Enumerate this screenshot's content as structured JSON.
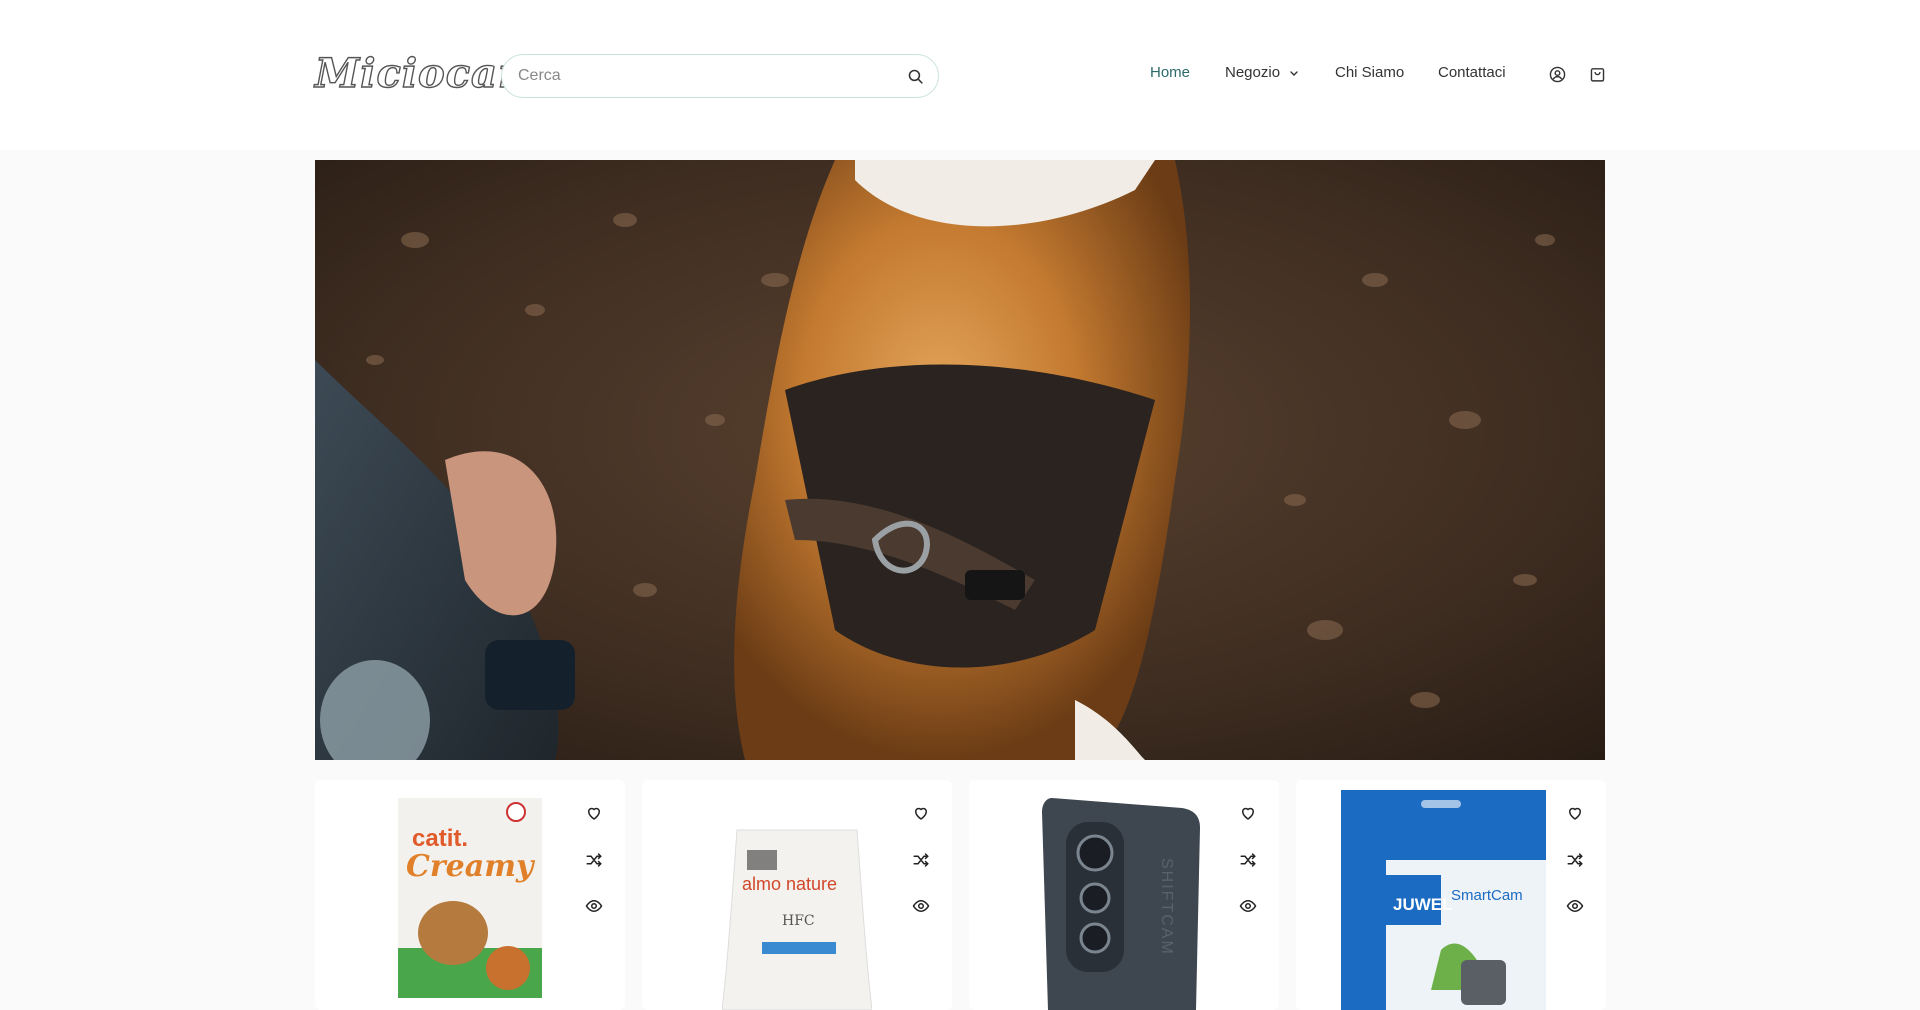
{
  "brand": {
    "name": "Miciocam"
  },
  "search": {
    "placeholder": "Cerca"
  },
  "nav": {
    "items": [
      {
        "label": "Home",
        "active": true
      },
      {
        "label": "Negozio",
        "has_dropdown": true
      },
      {
        "label": "Chi Siamo"
      },
      {
        "label": "Contattaci"
      }
    ]
  },
  "header_icons": [
    "account-icon",
    "cart-icon"
  ],
  "hero": {
    "image": "dog-harness-photo"
  },
  "products": [
    {
      "name": "catit Creamy",
      "image": "catit-creamy-pack",
      "actions": [
        "wishlist-icon",
        "compare-icon",
        "quick-view-icon"
      ]
    },
    {
      "name": "almo nature HFC",
      "image": "almo-nature-bag",
      "actions": [
        "wishlist-icon",
        "compare-icon",
        "quick-view-icon"
      ]
    },
    {
      "name": "SHIFTCAM",
      "image": "shiftcam-phone-case",
      "actions": [
        "wishlist-icon",
        "compare-icon",
        "quick-view-icon"
      ]
    },
    {
      "name": "JUWEL SmartCam",
      "image": "juwel-smartcam-box",
      "actions": [
        "wishlist-icon",
        "compare-icon",
        "quick-view-icon"
      ]
    }
  ],
  "colors": {
    "accent": "#2d6a6a",
    "search_border": "#c9e2df",
    "background": "#fafafa"
  }
}
